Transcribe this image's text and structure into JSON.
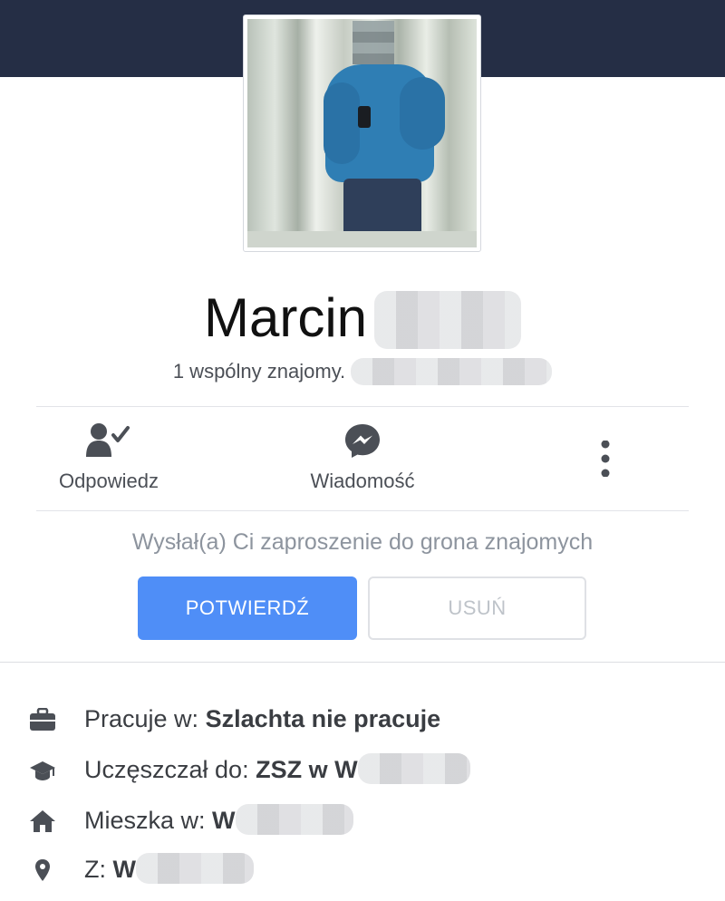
{
  "profile": {
    "name": "Marcin",
    "mutual_friends": "1 wspólny znajomy."
  },
  "actions": {
    "reply_label": "Odpowiedz",
    "message_label": "Wiadomość"
  },
  "friend_request": {
    "text": "Wysłał(a) Ci zaproszenie do grona znajomych",
    "confirm_label": "POTWIERDŹ",
    "remove_label": "USUŃ"
  },
  "info": {
    "work_prefix": "Pracuje w:",
    "work_value": "Szlachta nie pracuje",
    "school_prefix": "Uczęszczał do:",
    "school_value": "ZSZ w W",
    "lives_prefix": "Mieszka w:",
    "lives_value": "W",
    "from_prefix": "Z:",
    "from_value": "W"
  },
  "colors": {
    "header": "#252e45",
    "accent": "#4f8ef7",
    "icon": "#4b4f56"
  },
  "icons": [
    "friend-reply-icon",
    "messenger-icon",
    "more-vertical-icon",
    "briefcase-icon",
    "graduation-cap-icon",
    "home-icon",
    "location-pin-icon"
  ]
}
